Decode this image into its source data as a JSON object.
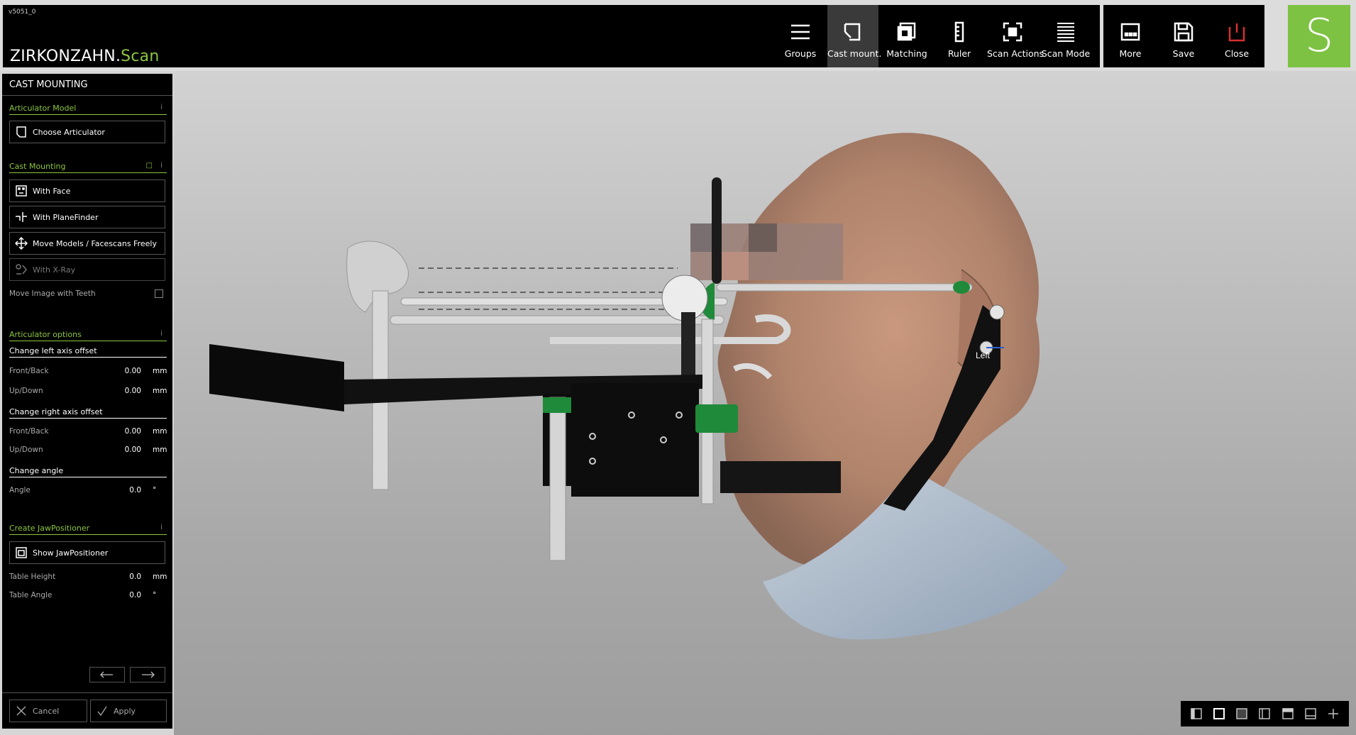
{
  "app": {
    "version": "v5051_0",
    "brand_main": "ZIRKONZAHN.",
    "brand_accent": "Scan",
    "logo_letter": "S"
  },
  "toolbar": {
    "tools": [
      {
        "label": "Groups",
        "icon": "menu-icon"
      },
      {
        "label": "Cast mount.",
        "icon": "cast-mount-icon",
        "active": true
      },
      {
        "label": "Matching",
        "icon": "matching-icon"
      },
      {
        "label": "Ruler",
        "icon": "ruler-icon"
      },
      {
        "label": "Scan Actions",
        "icon": "scan-actions-icon"
      },
      {
        "label": "Scan Mode",
        "icon": "scan-mode-icon"
      }
    ],
    "right_tools": [
      {
        "label": "More",
        "icon": "more-icon"
      },
      {
        "label": "Save",
        "icon": "save-icon"
      },
      {
        "label": "Close",
        "icon": "power-icon"
      }
    ]
  },
  "panel": {
    "title": "CAST MOUNTING",
    "articulator_model": {
      "heading": "Articulator Model",
      "info": "i",
      "choose_button": "Choose Articulator"
    },
    "cast_mounting": {
      "heading": "Cast Mounting",
      "info": "i",
      "buttons": [
        {
          "label": "With Face",
          "icon": "face-icon",
          "enabled": true
        },
        {
          "label": "With PlaneFinder",
          "icon": "planefinder-icon",
          "enabled": true
        },
        {
          "label": "Move Models / Facescans Freely",
          "icon": "move-icon",
          "enabled": true
        },
        {
          "label": "With X-Ray",
          "icon": "xray-icon",
          "enabled": false
        }
      ],
      "move_image_label": "Move Image with Teeth",
      "move_image_checked": false
    },
    "articulator_options": {
      "heading": "Articulator options",
      "info": "i",
      "left_axis": {
        "heading": "Change left axis offset",
        "rows": [
          {
            "label": "Front/Back",
            "value": "0.00",
            "unit": "mm"
          },
          {
            "label": "Up/Down",
            "value": "0.00",
            "unit": "mm"
          }
        ]
      },
      "right_axis": {
        "heading": "Change right axis offset",
        "rows": [
          {
            "label": "Front/Back",
            "value": "0.00",
            "unit": "mm"
          },
          {
            "label": "Up/Down",
            "value": "0.00",
            "unit": "mm"
          }
        ]
      },
      "angle": {
        "heading": "Change angle",
        "rows": [
          {
            "label": "Angle",
            "value": "0.0",
            "unit": "°"
          }
        ]
      }
    },
    "jaw_positioner": {
      "heading": "Create JawPositioner",
      "info": "i",
      "show_button": "Show JawPositioner",
      "rows": [
        {
          "label": "Table Height",
          "value": "0.0",
          "unit": "mm"
        },
        {
          "label": "Table Angle",
          "value": "0.0",
          "unit": "°"
        }
      ]
    },
    "footer": {
      "cancel": "Cancel",
      "apply": "Apply"
    }
  },
  "viewport": {
    "orientation_label": "Left"
  },
  "colors": {
    "accent_green": "#8cc63f",
    "logo_green": "#7dc242",
    "close_red": "#d63030",
    "toolbar_bg": "#000000",
    "active_tool_bg": "#3a3a3a"
  }
}
